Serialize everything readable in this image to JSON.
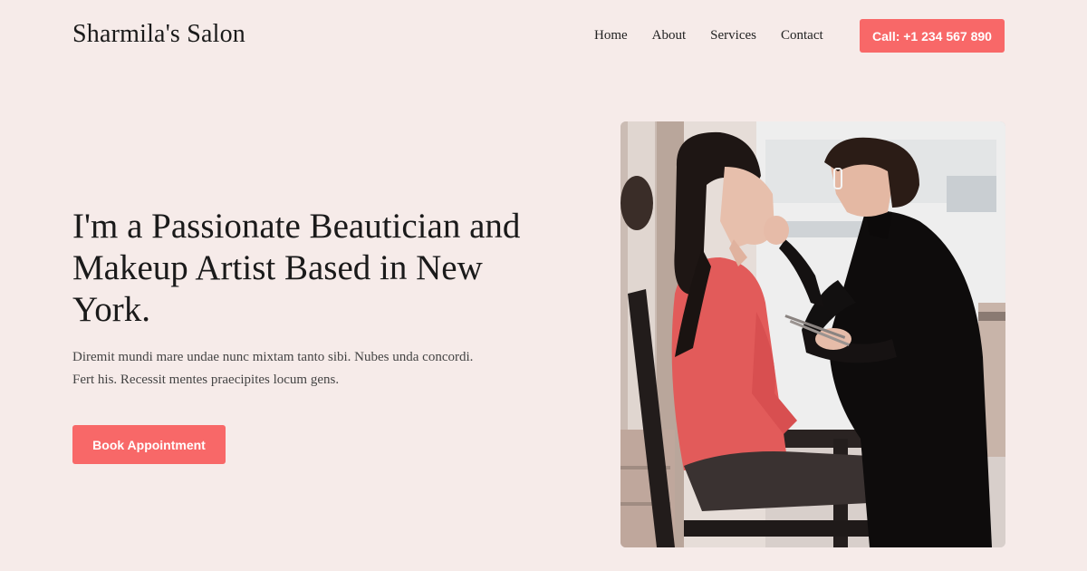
{
  "header": {
    "brand": "Sharmila's Salon",
    "nav": [
      "Home",
      "About",
      "Services",
      "Contact"
    ],
    "call_label": "Call: +1 234 567 890"
  },
  "hero": {
    "headline": "I'm a Passionate Beautician and Makeup Artist Based in New York.",
    "intro": "Diremit mundi mare undae nunc mixtam tanto sibi. Nubes unda concordi. Fert his. Recessit mentes praecipites locum gens.",
    "cta_label": "Book Appointment"
  },
  "colors": {
    "background": "#f6ebe9",
    "accent": "#f86868",
    "text": "#1a1a1a"
  }
}
